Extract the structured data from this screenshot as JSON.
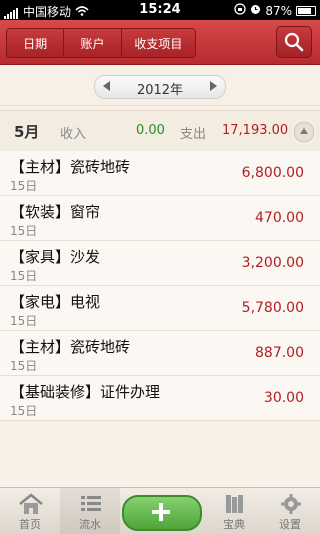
{
  "status_bar": {
    "carrier": "中国移动",
    "time": "15:24",
    "battery": "87%"
  },
  "header": {
    "segments": [
      "日期",
      "账户",
      "收支项目"
    ]
  },
  "year_selector": {
    "year": "2012年"
  },
  "month_summary": {
    "month": "5月",
    "income_label": "收入",
    "income_value": "0.00",
    "expense_label": "支出",
    "expense_value": "17,193.00"
  },
  "entries": [
    {
      "title": "【主材】瓷砖地砖",
      "date": "15日",
      "amount": "6,800.00"
    },
    {
      "title": "【软装】窗帘",
      "date": "15日",
      "amount": "470.00"
    },
    {
      "title": "【家具】沙发",
      "date": "15日",
      "amount": "3,200.00"
    },
    {
      "title": "【家电】电视",
      "date": "15日",
      "amount": "5,780.00"
    },
    {
      "title": "【主材】瓷砖地砖",
      "date": "15日",
      "amount": "887.00"
    },
    {
      "title": "【基础装修】证件办理",
      "date": "15日",
      "amount": "30.00"
    }
  ],
  "tabbar": {
    "home": "首页",
    "flow": "流水",
    "guide": "宝典",
    "settings": "设置"
  },
  "colors": {
    "header_red": "#c0353a",
    "income_green": "#2c8a2c",
    "expense_red": "#b31d23",
    "add_green": "#5cb346"
  }
}
